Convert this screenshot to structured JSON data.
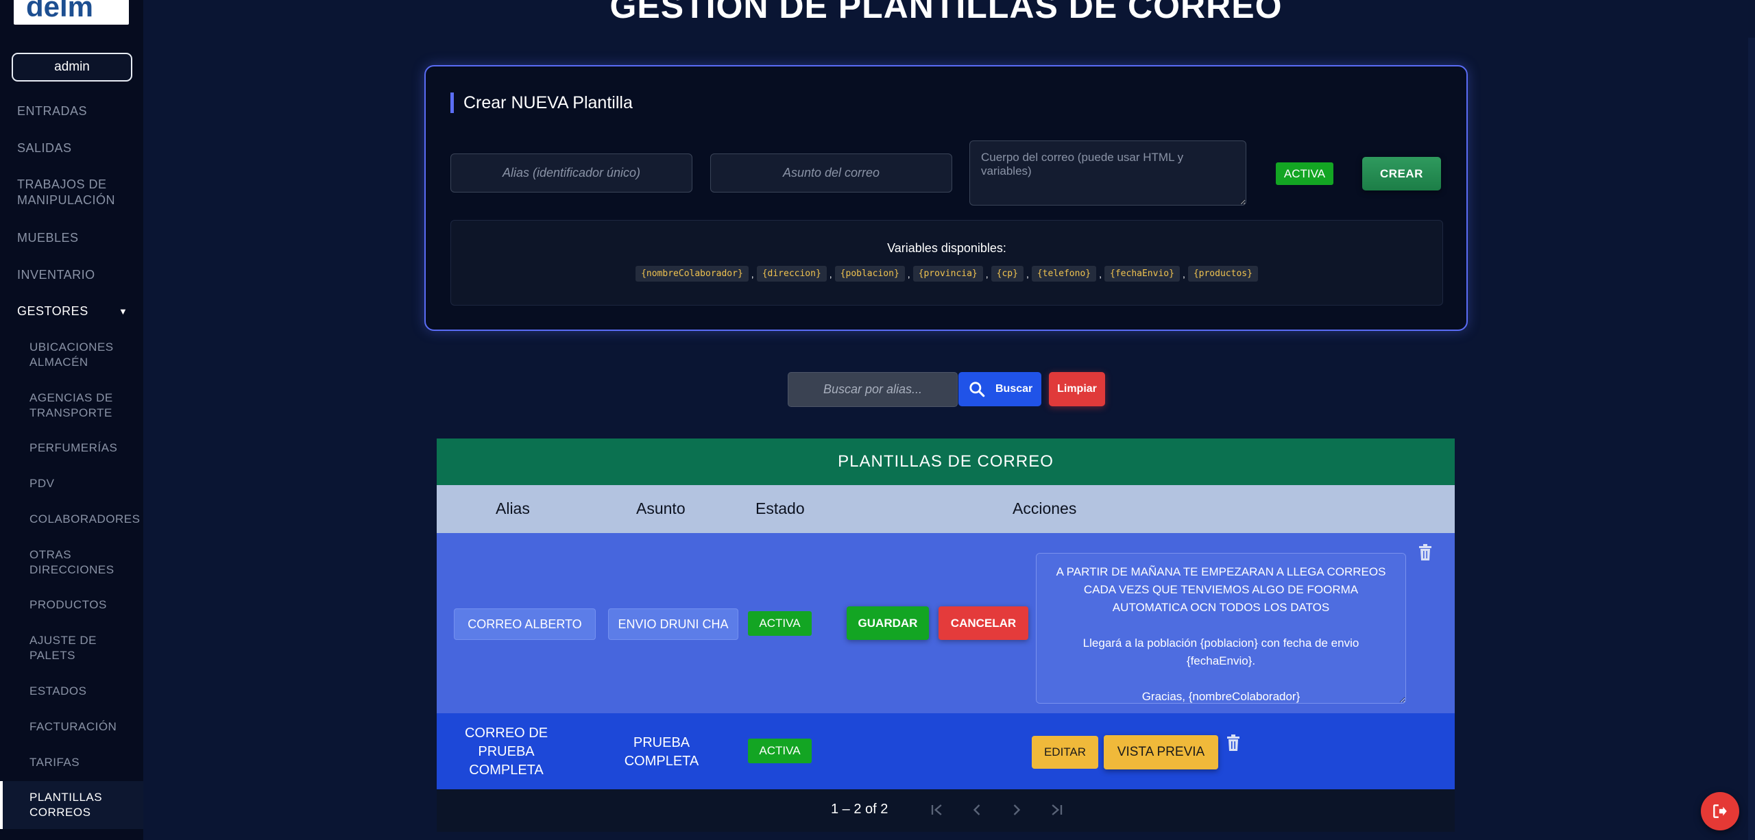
{
  "app": {
    "logo_text": "delm",
    "user": "admin"
  },
  "sidebar": {
    "items": [
      {
        "label": "ENTRADAS"
      },
      {
        "label": "SALIDAS"
      },
      {
        "label": "TRABAJOS DE MANIPULACIÓN"
      },
      {
        "label": "MUEBLES"
      },
      {
        "label": "INVENTARIO"
      },
      {
        "label": "GESTORES"
      }
    ],
    "subitems": [
      {
        "label": "UBICACIONES ALMACÉN"
      },
      {
        "label": "AGENCIAS DE TRANSPORTE"
      },
      {
        "label": "PERFUMERÍAS"
      },
      {
        "label": "PDV"
      },
      {
        "label": "COLABORADORES"
      },
      {
        "label": "OTRAS DIRECCIONES"
      },
      {
        "label": "PRODUCTOS"
      },
      {
        "label": "AJUSTE DE PALETS"
      },
      {
        "label": "ESTADOS"
      },
      {
        "label": "FACTURACIÓN"
      },
      {
        "label": "TARIFAS"
      },
      {
        "label": "PLANTILLAS CORREOS"
      }
    ]
  },
  "page": {
    "title": "GESTIÓN DE PLANTILLAS DE CORREO"
  },
  "create": {
    "heading": "Crear NUEVA Plantilla",
    "alias_placeholder": "Alias (identificador único)",
    "subject_placeholder": "Asunto del correo",
    "body_placeholder": "Cuerpo del correo (puede usar HTML y variables)",
    "status": "ACTIVA",
    "create_label": "CREAR",
    "vars_title": "Variables disponibles:",
    "variables": [
      "{nombreColaborador}",
      "{direccion}",
      "{poblacion}",
      "{provincia}",
      "{cp}",
      "{telefono}",
      "{fechaEnvio}",
      "{productos}"
    ]
  },
  "search": {
    "placeholder": "Buscar por alias...",
    "search_label": "Buscar",
    "clear_label": "Limpiar"
  },
  "table": {
    "title": "PLANTILLAS DE CORREO",
    "columns": [
      "Alias",
      "Asunto",
      "Estado",
      "Acciones"
    ],
    "edit_row": {
      "alias": "CORREO ALBERTO",
      "subject": "ENVIO DRUNI CHA",
      "status": "ACTIVA",
      "save_label": "GUARDAR",
      "cancel_label": "CANCELAR",
      "body": "A PARTIR DE MAÑANA TE EMPEZARAN A LLEGA CORREOS CADA VEZS QUE TENVIEMOS ALGO DE FOORMA AUTOMATICA OCN TODOS LOS DATOS\n\nLlegará a la población {poblacion} con fecha de envio {fechaEnvio}.\n\nGracias, {nombreColaborador}"
    },
    "view_row": {
      "alias": "CORREO DE PRUEBA COMPLETA",
      "subject": "PRUEBA COMPLETA",
      "status": "ACTIVA",
      "edit_label": "EDITAR",
      "preview_label": "VISTA PREVIA"
    },
    "pagination": "1 – 2 of 2"
  },
  "colors": {
    "accent": "#5b6ef5",
    "success": "#13a523",
    "danger": "#e43b3b",
    "warning": "#f0b93a",
    "table_header": "#0b7150"
  }
}
